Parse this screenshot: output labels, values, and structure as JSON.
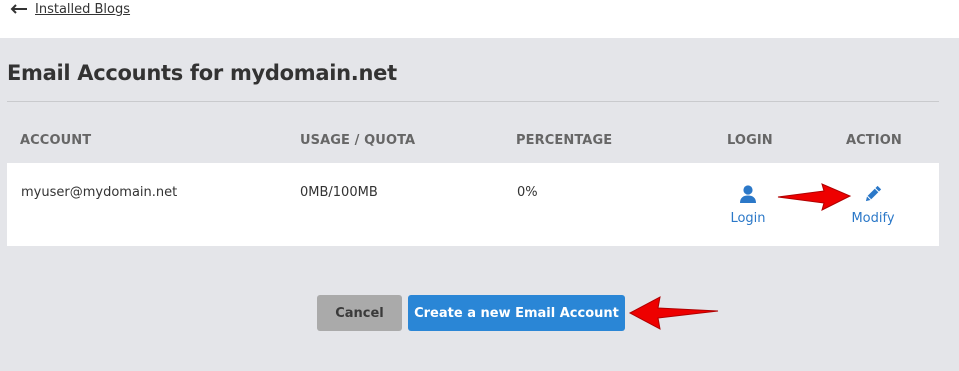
{
  "nav": {
    "back_label": "Installed Blogs",
    "back_icon": "arrow-left-icon"
  },
  "page": {
    "title": "Email Accounts for mydomain.net"
  },
  "table": {
    "headers": [
      "ACCOUNT",
      "USAGE / QUOTA",
      "PERCENTAGE",
      "LOGIN",
      "ACTION"
    ],
    "rows": [
      {
        "account": "myuser@mydomain.net",
        "usage_quota": "0MB/100MB",
        "percentage": "0%",
        "login_label": "Login",
        "login_icon": "user-icon",
        "action_label": "Modify",
        "action_icon": "pencil-icon"
      }
    ]
  },
  "buttons": {
    "cancel_label": "Cancel",
    "create_label": "Create a new Email Account"
  },
  "colors": {
    "panel_bg": "#e4e5e9",
    "link_blue": "#2b78c8",
    "primary_button": "#2a86d6",
    "cancel_button": "#aaaaaa",
    "annotation_red": "#ee0000"
  }
}
